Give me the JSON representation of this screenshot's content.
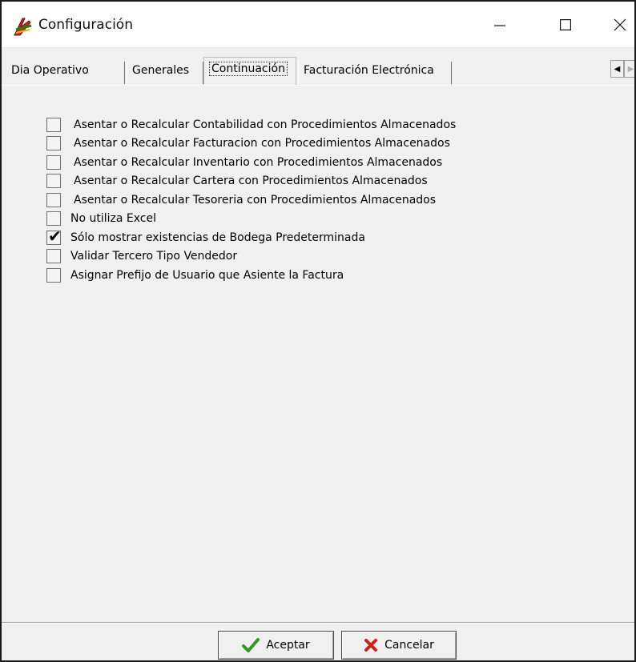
{
  "window": {
    "title": "Configuración",
    "minimize_glyph": "—",
    "maximize_glyph": "☐",
    "close_glyph": "✕"
  },
  "tabs": [
    {
      "label": "Dia Operativo",
      "active": false
    },
    {
      "label": "Generales",
      "active": false
    },
    {
      "label": "Continuación",
      "active": true
    },
    {
      "label": "Facturación Electrónica",
      "active": false
    }
  ],
  "tab_scroll": {
    "left": "◀",
    "right": "▶"
  },
  "options": [
    {
      "label": "Asentar o Recalcular Contabilidad con Procedimientos Almacenados",
      "checked": false
    },
    {
      "label": "Asentar o Recalcular Facturacion con Procedimientos Almacenados",
      "checked": false
    },
    {
      "label": "Asentar o Recalcular Inventario con Procedimientos Almacenados",
      "checked": false
    },
    {
      "label": "Asentar o Recalcular Cartera con Procedimientos Almacenados",
      "checked": false
    },
    {
      "label": "Asentar o Recalcular Tesoreria con Procedimientos Almacenados",
      "checked": false
    },
    {
      "label": "No utiliza Excel",
      "checked": false
    },
    {
      "label": "Sólo mostrar existencias de Bodega Predeterminada",
      "checked": true
    },
    {
      "label": "Validar Tercero Tipo Vendedor",
      "checked": false
    },
    {
      "label": "Asignar Prefijo de Usuario que Asiente la Factura",
      "checked": false
    }
  ],
  "check_glyph": "✔",
  "buttons": {
    "accept_label": "Aceptar",
    "cancel_label": "Cancelar"
  },
  "colors": {
    "accept_icon": "#2e9b1f",
    "cancel_icon": "#d01f14",
    "app_icon": "#cc2a1a"
  }
}
